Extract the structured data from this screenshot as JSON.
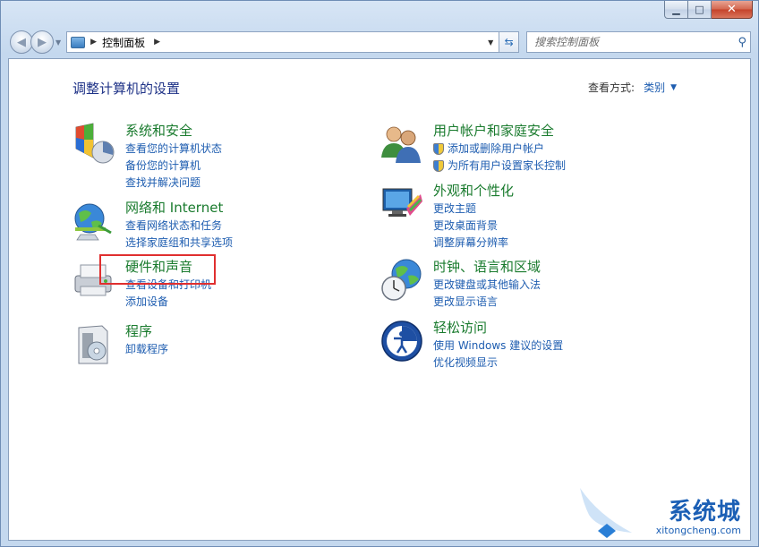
{
  "window": {
    "controls": {
      "minimize": "▁",
      "maximize": "□",
      "close": "✕"
    }
  },
  "address_bar": {
    "path": "控制面板",
    "icon": "control-panel-icon"
  },
  "search": {
    "placeholder": "搜索控制面板",
    "icon": "magnifier-icon"
  },
  "header": {
    "title": "调整计算机的设置",
    "view_by_label": "查看方式:",
    "view_by_value": "类别"
  },
  "categories_left": [
    {
      "title": "系统和安全",
      "icon": "system-security-icon",
      "links": [
        "查看您的计算机状态",
        "备份您的计算机",
        "查找并解决问题"
      ]
    },
    {
      "title": "网络和 Internet",
      "icon": "network-internet-icon",
      "links": [
        "查看网络状态和任务",
        "选择家庭组和共享选项"
      ]
    },
    {
      "title": "硬件和声音",
      "icon": "hardware-sound-icon",
      "links": [
        "查看设备和打印机",
        "添加设备"
      ]
    },
    {
      "title": "程序",
      "icon": "programs-icon",
      "links": [
        "卸载程序"
      ]
    }
  ],
  "categories_right": [
    {
      "title": "用户帐户和家庭安全",
      "icon": "user-accounts-icon",
      "links": [
        "添加或删除用户帐户",
        "为所有用户设置家长控制"
      ],
      "shield_links": true
    },
    {
      "title": "外观和个性化",
      "icon": "appearance-icon",
      "links": [
        "更改主题",
        "更改桌面背景",
        "调整屏幕分辨率"
      ]
    },
    {
      "title": "时钟、语言和区域",
      "icon": "clock-language-icon",
      "links": [
        "更改键盘或其他输入法",
        "更改显示语言"
      ]
    },
    {
      "title": "轻松访问",
      "icon": "ease-of-access-icon",
      "links": [
        "使用 Windows 建议的设置",
        "优化视频显示"
      ]
    }
  ],
  "watermark": {
    "main": "系统城",
    "sub": "xitongcheng.com"
  },
  "colors": {
    "category_title": "#1a7b2e",
    "link": "#1e5db0",
    "page_title": "#1e3287",
    "highlight": "#e02f2f"
  }
}
